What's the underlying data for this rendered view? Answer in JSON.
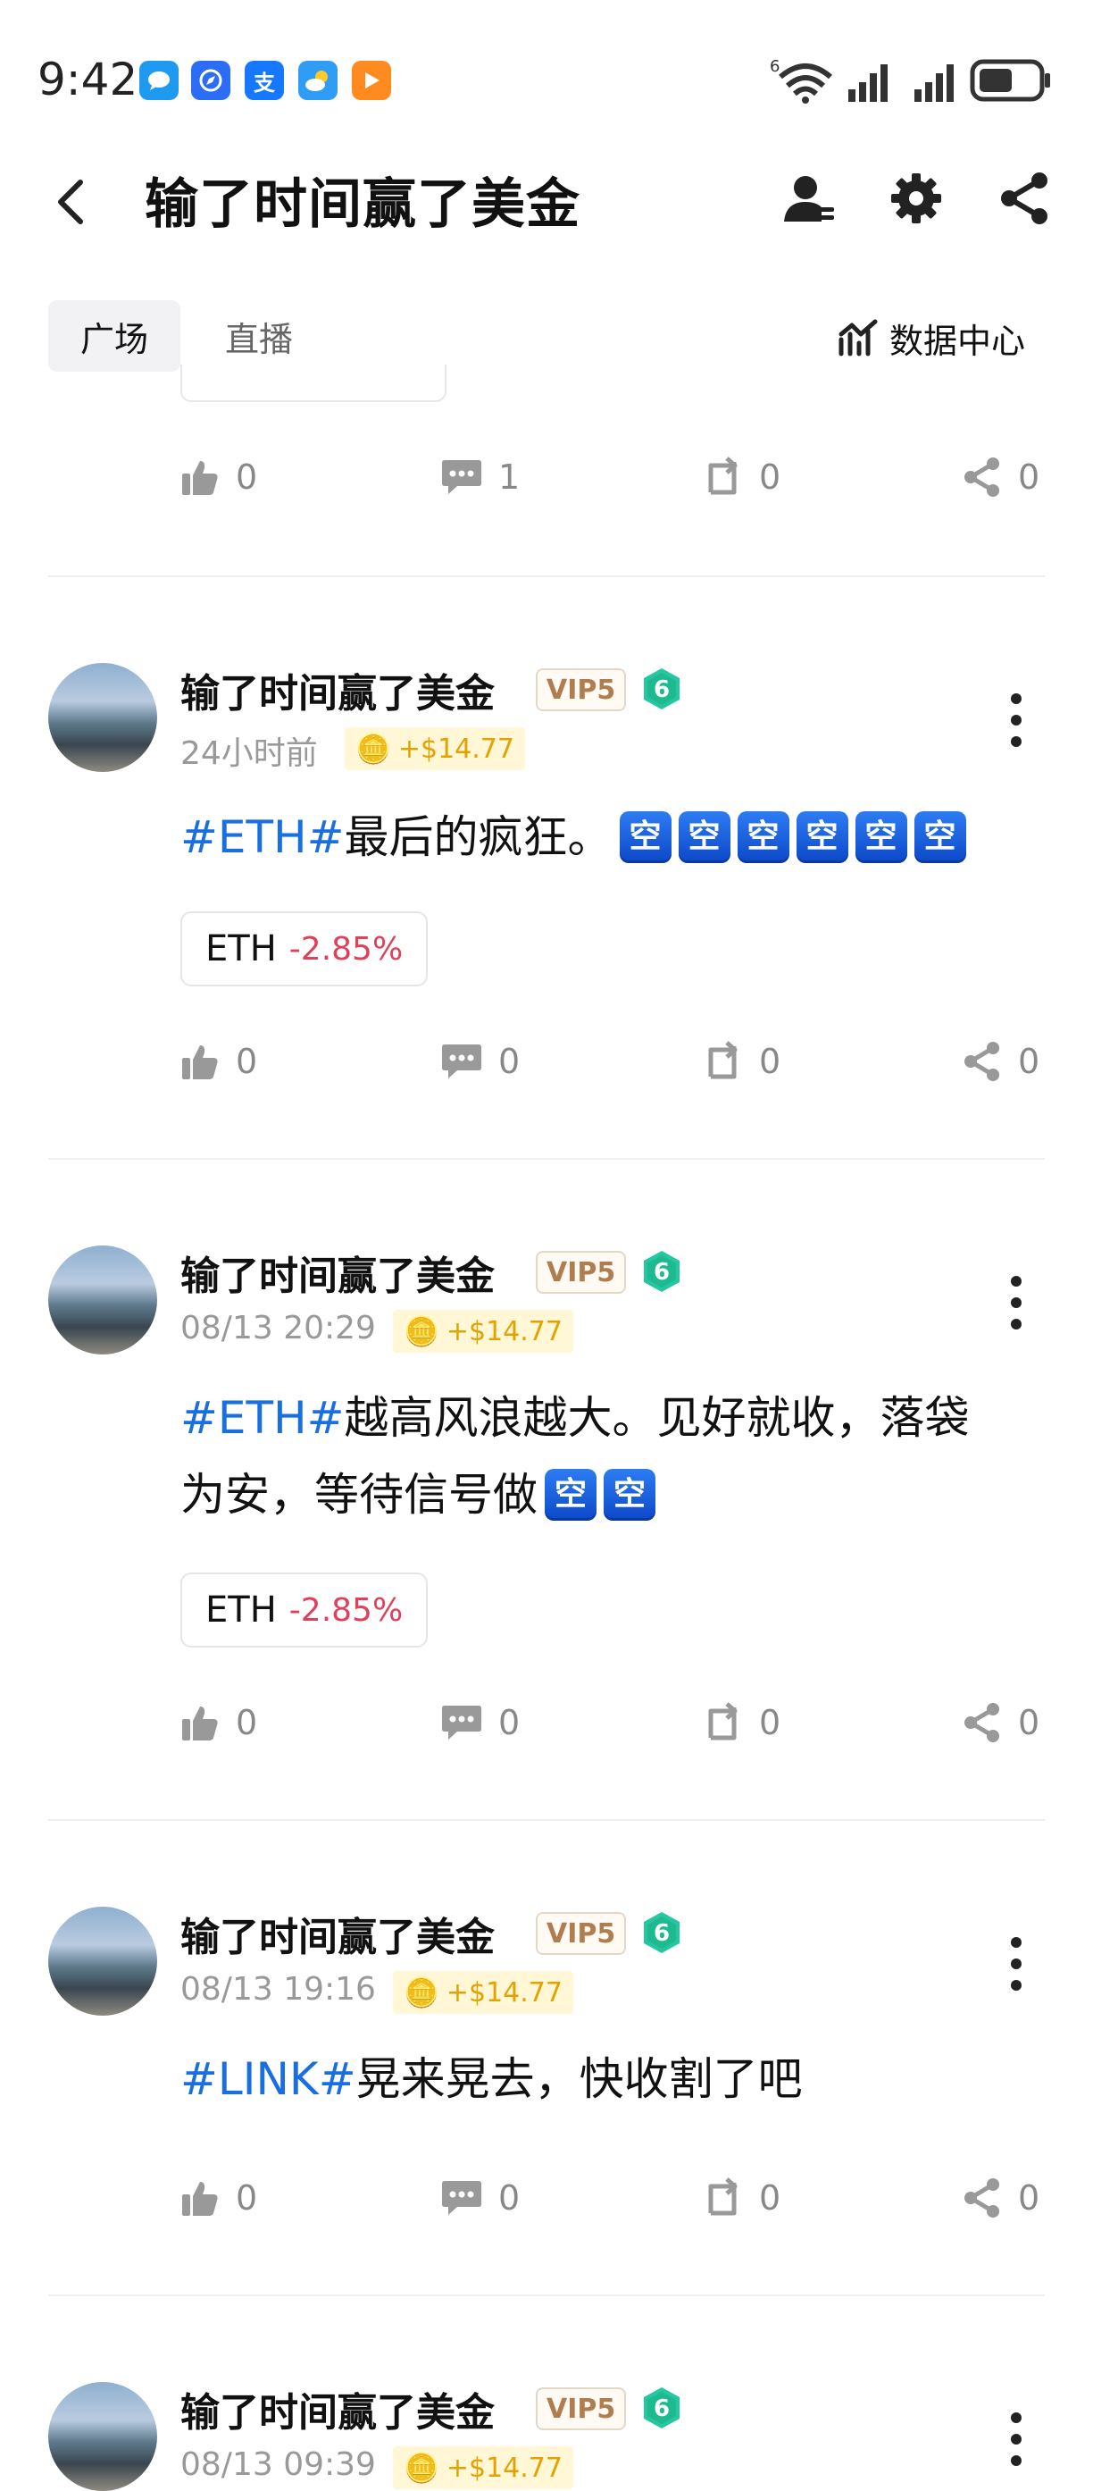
{
  "status_bar": {
    "time": "9:42"
  },
  "header": {
    "title": "输了时间赢了美金"
  },
  "tabs": [
    {
      "label": "广场"
    },
    {
      "label": "直播"
    }
  ],
  "data_center": {
    "label": "数据中心"
  },
  "truncated_post": {
    "likes": "0",
    "comments": "1",
    "reposts": "0",
    "shares": "0"
  },
  "posts": [
    {
      "username": "输了时间赢了美金",
      "vip": "VIP5",
      "level": "6",
      "time": "24小时前",
      "reward": "+$14.77",
      "hashtag": "#ETH#",
      "text": "最后的疯狂。",
      "emoji": "空",
      "emoji_count": 6,
      "ticker": {
        "symbol": "ETH",
        "change": "-2.85%"
      },
      "likes": "0",
      "comments": "0",
      "reposts": "0",
      "shares": "0"
    },
    {
      "username": "输了时间赢了美金",
      "vip": "VIP5",
      "level": "6",
      "time": "08/13 20:29",
      "reward": "+$14.77",
      "hashtag": "#ETH#",
      "text_line1": "越高风浪越大。见好就收，落袋",
      "text_line2": "为安，等待信号做",
      "emoji": "空",
      "emoji_count": 2,
      "ticker": {
        "symbol": "ETH",
        "change": "-2.85%"
      },
      "likes": "0",
      "comments": "0",
      "reposts": "0",
      "shares": "0"
    },
    {
      "username": "输了时间赢了美金",
      "vip": "VIP5",
      "level": "6",
      "time": "08/13 19:16",
      "reward": "+$14.77",
      "hashtag": "#LINK#",
      "text": "晃来晃去，快收割了吧",
      "likes": "0",
      "comments": "0",
      "reposts": "0",
      "shares": "0"
    },
    {
      "username": "输了时间赢了美金",
      "vip": "VIP5",
      "level": "6",
      "time": "08/13 09:39",
      "reward": "+$14.77"
    }
  ],
  "colors": {
    "hashtag": "#1a6fe0",
    "negative": "#e0405a",
    "reward": "#e3a200",
    "emoji_bg": "#1a5fdc"
  },
  "icons": {
    "status_apps": [
      "message-app-icon",
      "browser-app-icon",
      "alipay-app-icon",
      "weather-app-icon",
      "video-app-icon"
    ],
    "actions": [
      "thumbs-up-icon",
      "comment-icon",
      "repost-icon",
      "share-icon"
    ]
  }
}
